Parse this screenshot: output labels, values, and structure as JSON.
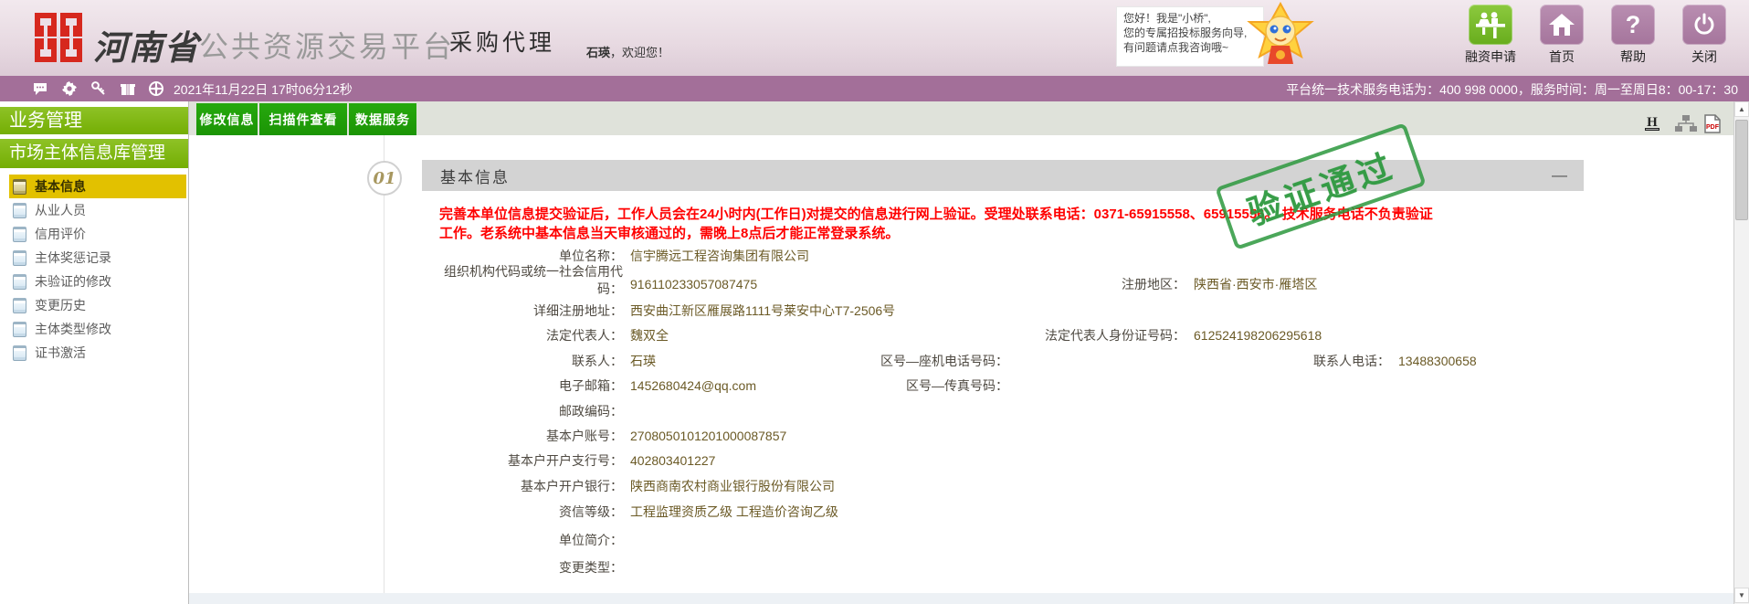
{
  "header": {
    "province": "河南省",
    "platform_name": "公共资源交易平台",
    "role": "采购代理",
    "welcome_user": "石瑛",
    "welcome_suffix": "，欢迎您！",
    "assistant": {
      "line1": "您好！我是\"小桥\",",
      "line2": "您的专属招投标服务向导,",
      "line3": "有问题请点我咨询哦~"
    },
    "nav": {
      "finance": "融资申请",
      "home": "首页",
      "help": "帮助",
      "close": "关闭"
    }
  },
  "statusbar": {
    "datetime": "2021年11月22日 17时06分12秒",
    "service_info": "平台统一技术服务电话为：400 998 0000，服务时间：周一至周日8：00-17：30"
  },
  "sidebar": {
    "section1": "业务管理",
    "section2": "市场主体信息库管理",
    "items": [
      {
        "label": "基本信息"
      },
      {
        "label": "从业人员"
      },
      {
        "label": "信用评价"
      },
      {
        "label": "主体奖惩记录"
      },
      {
        "label": "未验证的修改"
      },
      {
        "label": "变更历史"
      },
      {
        "label": "主体类型修改"
      },
      {
        "label": "证书激活"
      }
    ]
  },
  "toolbar": {
    "edit": "修改信息",
    "scan": "扫描件查看",
    "data": "数据服务"
  },
  "section": {
    "number": "01",
    "title": "基本信息",
    "collapse": "—"
  },
  "warning": {
    "line1": "完善本单位信息提交验证后，工作人员会在24小时内(工作日)对提交的信息进行网上验证。受理处联系电话：0371-65915558、65915556。 技术服务电话不负责验证",
    "line2": "工作。老系统中基本信息当天审核通过的，需晚上8点后才能正常登录系统。"
  },
  "stamp": {
    "text": "验证通过"
  },
  "form": {
    "unit_name": {
      "label": "单位名称：",
      "value": "信宇腾远工程咨询集团有限公司"
    },
    "credit_code": {
      "label": "组织机构代码或统一社会信用代码：",
      "value": "916110233057087475"
    },
    "reg_region": {
      "label": "注册地区：",
      "value": "陕西省·西安市·雁塔区"
    },
    "reg_address": {
      "label": "详细注册地址：",
      "value": "西安曲江新区雁展路1111号莱安中心T7-2506号"
    },
    "legal_rep": {
      "label": "法定代表人：",
      "value": "魏双全"
    },
    "legal_rep_id": {
      "label": "法定代表人身份证号码：",
      "value": "612524198206295618"
    },
    "contact": {
      "label": "联系人：",
      "value": "石瑛"
    },
    "landline": {
      "label": "区号—座机电话号码：",
      "value": ""
    },
    "contact_phone": {
      "label": "联系人电话：",
      "value": "13488300658"
    },
    "email": {
      "label": "电子邮箱：",
      "value": "1452680424@qq.com"
    },
    "fax": {
      "label": "区号—传真号码：",
      "value": ""
    },
    "postcode": {
      "label": "邮政编码：",
      "value": ""
    },
    "bank_account": {
      "label": "基本户账号：",
      "value": "2708050101201000087857"
    },
    "bank_branch_no": {
      "label": "基本户开户支行号：",
      "value": "402803401227"
    },
    "bank_name": {
      "label": "基本户开户银行：",
      "value": "陕西商南农村商业银行股份有限公司"
    },
    "credit_rating": {
      "label": "资信等级：",
      "value": "工程监理资质乙级 工程造价咨询乙级"
    },
    "profile": {
      "label": "单位简介：",
      "value": ""
    },
    "change_type": {
      "label": "变更类型：",
      "value": ""
    }
  },
  "scrollbar": {
    "up": "▲",
    "down": "▼"
  },
  "colors": {
    "toolbar_green": "#1f9d08",
    "sidebar_green": "#7cb806",
    "active_yellow": "#e2c100",
    "purple_bar": "#a36f99",
    "stamp_green": "#2a963c",
    "warning_red": "#ff0000",
    "finance_green": "#72b32a"
  }
}
